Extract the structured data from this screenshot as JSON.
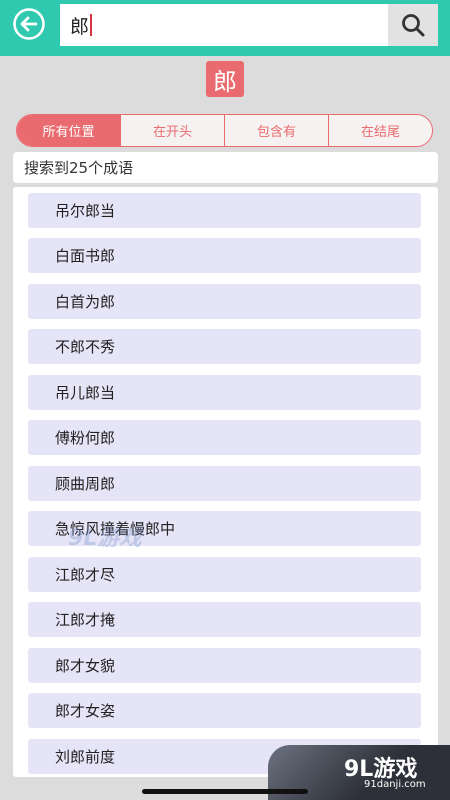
{
  "search": {
    "value": "郎"
  },
  "char_badge": "郎",
  "tabs": [
    {
      "label": "所有位置",
      "active": true
    },
    {
      "label": "在开头",
      "active": false
    },
    {
      "label": "包含有",
      "active": false
    },
    {
      "label": "在结尾",
      "active": false
    }
  ],
  "result_count": {
    "prefix": "搜索到",
    "count": "25",
    "suffix": "个成语"
  },
  "results": [
    "吊尔郎当",
    "白面书郎",
    "白首为郎",
    "不郎不秀",
    "吊儿郎当",
    "傅粉何郎",
    "顾曲周郎",
    "急惊风撞着慢郎中",
    "江郎才尽",
    "江郎才掩",
    "郎才女貌",
    "郎才女姿",
    "刘郎前度"
  ],
  "ad": {
    "logo": "9L游戏",
    "url": "91danji.com"
  },
  "watermark": "9L游戏",
  "colors": {
    "topbar": "#2fc9b0",
    "accent": "#ea6b6f",
    "item_bg": "#e6e4f7"
  },
  "icons": {
    "back": "arrow-left-circle",
    "search": "magnifier"
  }
}
